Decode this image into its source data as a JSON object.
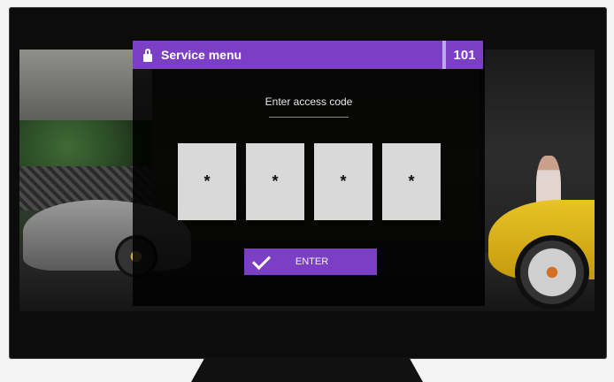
{
  "menu": {
    "title": "Service menu",
    "channel_number": "101",
    "icon": "lock-icon"
  },
  "access": {
    "prompt": "Enter access code",
    "digits": [
      "*",
      "*",
      "*",
      "*"
    ]
  },
  "enter_button": {
    "label": "ENTER",
    "icon": "check-icon"
  },
  "colors": {
    "accent": "#7a3fc4",
    "code_box": "#d9d9d9"
  }
}
